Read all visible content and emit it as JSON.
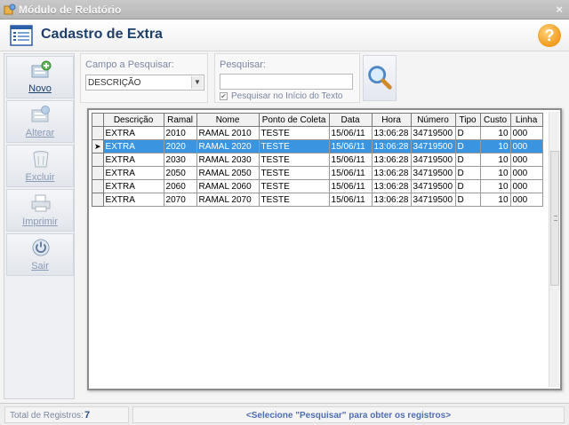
{
  "window": {
    "title": "Módulo de Relatório",
    "close_glyph": "×"
  },
  "header": {
    "title": "Cadastro de Extra",
    "help_glyph": "?"
  },
  "sidebar": {
    "items": [
      {
        "label": "Novo",
        "icon": "new-record-icon",
        "enabled": true
      },
      {
        "label": "Alterar",
        "icon": "edit-record-icon",
        "enabled": false
      },
      {
        "label": "Excluir",
        "icon": "trash-icon",
        "enabled": false
      },
      {
        "label": "Imprimir",
        "icon": "printer-icon",
        "enabled": false
      },
      {
        "label": "Sair",
        "icon": "power-icon",
        "enabled": true
      }
    ]
  },
  "search": {
    "field_label": "Campo a Pesquisar:",
    "field_value": "DESCRIÇÃO",
    "query_label": "Pesquisar:",
    "query_value": "",
    "start_only_label": "Pesquisar no Início do Texto",
    "start_only_checked": true
  },
  "grid": {
    "columns": [
      "Descrição",
      "Ramal",
      "Nome",
      "Ponto de Coleta",
      "Data",
      "Hora",
      "Número",
      "Tipo",
      "Custo",
      "Linha"
    ],
    "selected_row_index": 1,
    "current_row_marker": "➤",
    "rows": [
      [
        "EXTRA",
        "2010",
        "RAMAL 2010",
        "TESTE",
        "15/06/11",
        "13:06:28",
        "34719500",
        "D",
        "10",
        "000"
      ],
      [
        "EXTRA",
        "2020",
        "RAMAL 2020",
        "TESTE",
        "15/06/11",
        "13:06:28",
        "34719500",
        "D",
        "10",
        "000"
      ],
      [
        "EXTRA",
        "2030",
        "RAMAL 2030",
        "TESTE",
        "15/06/11",
        "13:06:28",
        "34719500",
        "D",
        "10",
        "000"
      ],
      [
        "EXTRA",
        "2050",
        "RAMAL 2050",
        "TESTE",
        "15/06/11",
        "13:06:28",
        "34719500",
        "D",
        "10",
        "000"
      ],
      [
        "EXTRA",
        "2060",
        "RAMAL 2060",
        "TESTE",
        "15/06/11",
        "13:06:28",
        "34719500",
        "D",
        "10",
        "000"
      ],
      [
        "EXTRA",
        "2070",
        "RAMAL 2070",
        "TESTE",
        "15/06/11",
        "13:06:28",
        "34719500",
        "D",
        "10",
        "000"
      ]
    ]
  },
  "status": {
    "total_label": "Total de Registros:",
    "total_value": "7",
    "message": "<Selecione \"Pesquisar\" para obter os registros>"
  },
  "colors": {
    "selection": "#3a94e0",
    "title_text": "#1f3f6b",
    "help_accent": "#f29a1c"
  }
}
